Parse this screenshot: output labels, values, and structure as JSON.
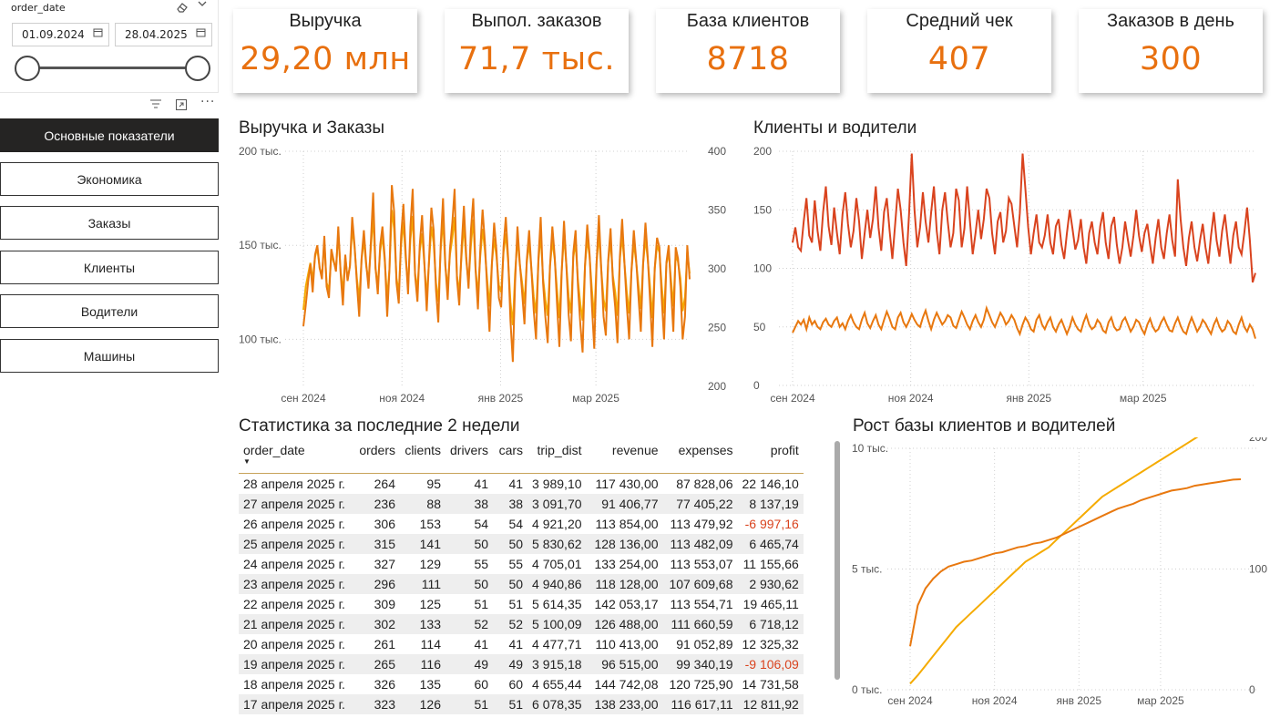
{
  "slicer": {
    "field": "order_date",
    "start_date": "01.09.2024",
    "end_date": "28.04.2025",
    "icons": [
      "eraser-icon",
      "chevron-down-icon",
      "calendar-icon",
      "filter-icon",
      "focus-mode-icon",
      "more-options-icon"
    ]
  },
  "nav": {
    "items": [
      {
        "label": "Основные показатели",
        "active": true
      },
      {
        "label": "Экономика",
        "active": false
      },
      {
        "label": "Заказы",
        "active": false
      },
      {
        "label": "Клиенты",
        "active": false
      },
      {
        "label": "Водители",
        "active": false
      },
      {
        "label": "Машины",
        "active": false
      }
    ]
  },
  "kpis": [
    {
      "label": "Выручка",
      "value": "29,20 млн"
    },
    {
      "label": "Выпол. заказов",
      "value": "71,7 тыс."
    },
    {
      "label": "База клиентов",
      "value": "8718"
    },
    {
      "label": "Средний чек",
      "value": "407"
    },
    {
      "label": "Заказов в день",
      "value": "300"
    }
  ],
  "colors": {
    "accent": "#e8700f",
    "revenue": "#e8780f",
    "orders": "#f5ab00",
    "clients": "#d9431e",
    "drivers": "#e8780f",
    "negative": "#d9431e"
  },
  "chart_data": [
    {
      "type": "line",
      "title": "Выручка и Заказы",
      "x_ticks": [
        "сен 2024",
        "ноя 2024",
        "янв 2025",
        "мар 2025"
      ],
      "y_left_ticks": [
        "200 тыс.",
        "150 тыс.",
        "100 тыс."
      ],
      "y_left_range": [
        75000,
        200000
      ],
      "y_right_ticks": [
        "400",
        "350",
        "300",
        "250",
        "200"
      ],
      "y_right_range": [
        200,
        400
      ],
      "x_range": [
        "2024-09-01",
        "2025-04-28"
      ],
      "series": [
        {
          "values": [
            107000,
            118000,
            130000,
            140000,
            125000,
            145000,
            150000,
            138000,
            132000,
            155000,
            128000,
            122000,
            148000,
            142000,
            136000,
            160000,
            135000,
            118000,
            145000,
            131000,
            139000,
            165000,
            150000,
            130000,
            112000,
            143000,
            158000,
            140000,
            127000,
            152000,
            178000,
            138000,
            124000,
            150000,
            160000,
            143000,
            112000,
            137000,
            182000,
            168000,
            130000,
            119000,
            155000,
            172000,
            145000,
            124000,
            160000,
            180000,
            134000,
            120000,
            150000,
            166000,
            141000,
            115000,
            142000,
            170000,
            158000,
            126000,
            109000,
            150000,
            175000,
            140000,
            121000,
            148000,
            162000,
            180000,
            132000,
            118000,
            149000,
            171000,
            144000,
            127000,
            158000,
            175000,
            137000,
            116000,
            147000,
            169000,
            152000,
            126000,
            104000,
            140000,
            162000,
            147000,
            122000,
            117000,
            149000,
            165000,
            143000,
            110000,
            88000,
            130000,
            160000,
            141000,
            125000,
            108000,
            142000,
            158000,
            137000,
            115000,
            100000,
            143000,
            165000,
            130000,
            112000,
            98000,
            139000,
            160000,
            144000,
            119000,
            96000,
            135000,
            163000,
            140000,
            113000,
            99000,
            146000,
            158000,
            128000,
            108000,
            93000,
            139000,
            161000,
            145000,
            118000,
            95000,
            140000,
            166000,
            138000,
            112000,
            102000,
            142000,
            159000,
            131000,
            117000,
            98000,
            144000,
            164000,
            140000,
            118000,
            100000,
            136000,
            158000,
            142000,
            123000,
            104000,
            140000,
            162000,
            144000,
            120000,
            96000,
            138000,
            154000,
            149000,
            122000,
            100000,
            141000,
            150000,
            126000,
            104000,
            149000,
            143000,
            128000,
            100000,
            112000,
            150000,
            132000
          ]
        },
        {
          "values": [
            265,
            285,
            295,
            305,
            290,
            310,
            318,
            300,
            295,
            322,
            288,
            282,
            312,
            306,
            300,
            330,
            298,
            280,
            310,
            292,
            302,
            335,
            318,
            292,
            274,
            308,
            325,
            302,
            290,
            318,
            345,
            300,
            286,
            315,
            328,
            306,
            275,
            300,
            350,
            334,
            292,
            280,
            320,
            340,
            308,
            285,
            325,
            345,
            296,
            282,
            315,
            330,
            304,
            276,
            305,
            336,
            322,
            288,
            272,
            316,
            342,
            302,
            284,
            312,
            326,
            344,
            294,
            280,
            312,
            338,
            307,
            288,
            320,
            342,
            300,
            278,
            310,
            334,
            316,
            290,
            268,
            304,
            326,
            310,
            286,
            280,
            314,
            330,
            306,
            272,
            252,
            296,
            326,
            304,
            288,
            270,
            305,
            322,
            300,
            276,
            262,
            306,
            330,
            292,
            274,
            260,
            302,
            324,
            308,
            282,
            258,
            298,
            328,
            304,
            276,
            262,
            310,
            322,
            290,
            270,
            256,
            302,
            326,
            310,
            282,
            258,
            304,
            330,
            300,
            274,
            264,
            306,
            324,
            294,
            280,
            260,
            308,
            328,
            304,
            280,
            262,
            298,
            322,
            306,
            286,
            266,
            304,
            326,
            308,
            284,
            258,
            300,
            320,
            314,
            286,
            262,
            304,
            314,
            290,
            268,
            312,
            306,
            292,
            264,
            276,
            314,
            296
          ]
        }
      ]
    },
    {
      "type": "line",
      "title": "Клиенты и водители",
      "x_ticks": [
        "сен 2024",
        "ноя 2024",
        "янв 2025",
        "мар 2025"
      ],
      "y_ticks": [
        "200",
        "150",
        "100",
        "50",
        "0"
      ],
      "ylim": [
        0,
        200
      ],
      "x_range": [
        "2024-09-01",
        "2025-04-28"
      ],
      "series": [
        {
          "values": [
            122,
            135,
            118,
            115,
            140,
            160,
            128,
            122,
            158,
            132,
            115,
            148,
            170,
            136,
            120,
            152,
            130,
            112,
            146,
            165,
            138,
            118,
            132,
            160,
            140,
            108,
            130,
            150,
            126,
            142,
            170,
            135,
            115,
            148,
            160,
            132,
            108,
            138,
            168,
            150,
            122,
            102,
            146,
            198,
            150,
            118,
            135,
            165,
            140,
            122,
            148,
            170,
            132,
            112,
            150,
            165,
            140,
            118,
            130,
            168,
            158,
            118,
            134,
            170,
            140,
            112,
            130,
            150,
            125,
            142,
            168,
            160,
            130,
            112,
            140,
            148,
            122,
            132,
            160,
            155,
            136,
            118,
            147,
            198,
            168,
            135,
            112,
            130,
            146,
            122,
            118,
            128,
            146,
            122,
            112,
            136,
            142,
            120,
            108,
            130,
            150,
            134,
            116,
            124,
            142,
            118,
            104,
            130,
            140,
            122,
            112,
            136,
            148,
            122,
            108,
            136,
            144,
            120,
            104,
            118,
            140,
            124,
            110,
            128,
            150,
            128,
            114,
            130,
            138,
            120,
            104,
            126,
            142,
            118,
            108,
            130,
            146,
            124,
            110,
            176,
            142,
            118,
            102,
            126,
            140,
            118,
            106,
            124,
            138,
            118,
            104,
            128,
            148,
            124,
            110,
            132,
            146,
            124,
            104,
            128,
            140,
            118,
            112,
            130,
            152,
            124,
            88,
            96
          ]
        },
        {
          "values": [
            45,
            50,
            55,
            52,
            56,
            48,
            58,
            52,
            55,
            50,
            48,
            54,
            57,
            52,
            50,
            55,
            58,
            50,
            53,
            48,
            55,
            60,
            54,
            50,
            48,
            56,
            62,
            53,
            49,
            55,
            60,
            52,
            48,
            56,
            63,
            57,
            50,
            48,
            58,
            62,
            54,
            50,
            55,
            61,
            56,
            52,
            50,
            58,
            64,
            55,
            48,
            56,
            62,
            57,
            52,
            55,
            60,
            58,
            51,
            49,
            56,
            63,
            58,
            52,
            48,
            55,
            60,
            54,
            50,
            56,
            66,
            60,
            54,
            50,
            56,
            62,
            58,
            52,
            55,
            60,
            56,
            49,
            44,
            52,
            58,
            54,
            48,
            46,
            56,
            60,
            52,
            48,
            54,
            58,
            50,
            46,
            52,
            56,
            50,
            44,
            50,
            58,
            52,
            48,
            46,
            54,
            60,
            52,
            48,
            50,
            56,
            53,
            47,
            45,
            54,
            58,
            50,
            47,
            48,
            55,
            58,
            52,
            46,
            50,
            56,
            54,
            48,
            44,
            52,
            57,
            50,
            46,
            48,
            54,
            58,
            52,
            47,
            46,
            53,
            58,
            51,
            46,
            44,
            52,
            58,
            52,
            46,
            50,
            56,
            53,
            48,
            44,
            52,
            57,
            50,
            46,
            48,
            55,
            52,
            46,
            44,
            52,
            58,
            50,
            46,
            52,
            48,
            40
          ]
        }
      ]
    },
    {
      "type": "line",
      "title": "Рост базы клиентов и водителей",
      "x_ticks": [
        "сен 2024",
        "ноя 2024",
        "янв 2025",
        "мар 2025"
      ],
      "y_left_ticks": [
        "10 тыс.",
        "5 тыс.",
        "0 тыс."
      ],
      "y_left_range": [
        0,
        10000
      ],
      "y_right_ticks": [
        "200",
        "100",
        "0"
      ],
      "y_right_range": [
        0,
        200
      ],
      "x_range": [
        "2024-09-01",
        "2025-04-28"
      ],
      "series": [
        {
          "values": [
            1800,
            3500,
            4200,
            4600,
            4900,
            5100,
            5200,
            5300,
            5350,
            5450,
            5550,
            5650,
            5700,
            5800,
            5900,
            5950,
            6050,
            6100,
            6200,
            6300,
            6450,
            6600,
            6750,
            6900,
            7050,
            7200,
            7350,
            7500,
            7600,
            7700,
            7850,
            7950,
            8050,
            8150,
            8250,
            8300,
            8350,
            8450,
            8500,
            8550,
            8600,
            8650,
            8700,
            8718
          ]
        },
        {
          "values": [
            5,
            12,
            20,
            28,
            36,
            44,
            52,
            58,
            64,
            70,
            76,
            82,
            88,
            94,
            100,
            106,
            110,
            114,
            118,
            124,
            130,
            136,
            142,
            148,
            154,
            160,
            164,
            168,
            172,
            176,
            180,
            184,
            188,
            192,
            196,
            200,
            204,
            208,
            212,
            216,
            220,
            224,
            228,
            230
          ]
        }
      ]
    },
    {
      "type": "table",
      "title": "Статистика за последние 2 недели",
      "columns": [
        "order_date",
        "orders",
        "clients",
        "drivers",
        "cars",
        "trip_dist",
        "revenue",
        "expenses",
        "profit"
      ],
      "rows": [
        [
          "28 апреля 2025 г.",
          "264",
          "95",
          "41",
          "41",
          "3 989,10",
          "117 430,00",
          "87 828,06",
          "22 146,10"
        ],
        [
          "27 апреля 2025 г.",
          "236",
          "88",
          "38",
          "38",
          "3 091,70",
          "91 406,77",
          "77 405,22",
          "8 137,19"
        ],
        [
          "26 апреля 2025 г.",
          "306",
          "153",
          "54",
          "54",
          "4 921,20",
          "113 854,00",
          "113 479,92",
          "-6 997,16"
        ],
        [
          "25 апреля 2025 г.",
          "315",
          "141",
          "50",
          "50",
          "5 830,62",
          "128 136,00",
          "113 482,09",
          "6 465,74"
        ],
        [
          "24 апреля 2025 г.",
          "327",
          "129",
          "55",
          "55",
          "4 705,01",
          "133 254,00",
          "113 553,07",
          "11 155,66"
        ],
        [
          "23 апреля 2025 г.",
          "296",
          "111",
          "50",
          "50",
          "4 940,86",
          "118 128,00",
          "107 609,68",
          "2 930,62"
        ],
        [
          "22 апреля 2025 г.",
          "309",
          "125",
          "51",
          "51",
          "5 614,35",
          "142 053,17",
          "113 554,71",
          "19 465,11"
        ],
        [
          "21 апреля 2025 г.",
          "302",
          "133",
          "52",
          "52",
          "5 100,09",
          "126 488,00",
          "111 660,59",
          "6 718,12"
        ],
        [
          "20 апреля 2025 г.",
          "261",
          "114",
          "41",
          "41",
          "4 477,71",
          "110 413,00",
          "91 052,89",
          "12 325,32"
        ],
        [
          "19 апреля 2025 г.",
          "265",
          "116",
          "49",
          "49",
          "3 915,18",
          "96 515,00",
          "99 340,19",
          "-9 106,09"
        ],
        [
          "18 апреля 2025 г.",
          "326",
          "135",
          "60",
          "60",
          "4 655,44",
          "144 742,08",
          "120 725,90",
          "14 731,58"
        ],
        [
          "17 апреля 2025 г.",
          "323",
          "126",
          "51",
          "51",
          "6 078,35",
          "138 233,00",
          "116 617,11",
          "12 811,92"
        ]
      ]
    }
  ]
}
